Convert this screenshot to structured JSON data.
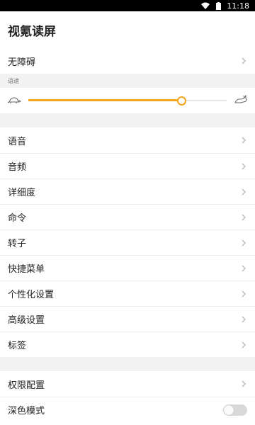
{
  "status": {
    "time": "11:18"
  },
  "title": "视氪读屏",
  "accessibility_label": "无障碍",
  "speed": {
    "label": "语速",
    "value_fraction": 0.77,
    "accent": "#f3a51b"
  },
  "menu": [
    {
      "name": "voice",
      "label": "语音"
    },
    {
      "name": "audio",
      "label": "音频"
    },
    {
      "name": "verbosity",
      "label": "详细度"
    },
    {
      "name": "commands",
      "label": "命令"
    },
    {
      "name": "rotor",
      "label": "转子"
    },
    {
      "name": "shortcut-menu",
      "label": "快捷菜单"
    },
    {
      "name": "personalization",
      "label": "个性化设置"
    },
    {
      "name": "advanced",
      "label": "高级设置"
    },
    {
      "name": "labels",
      "label": "标签"
    }
  ],
  "permissions": {
    "label": "权限配置"
  },
  "dark_mode": {
    "label": "深色模式",
    "on": false
  }
}
